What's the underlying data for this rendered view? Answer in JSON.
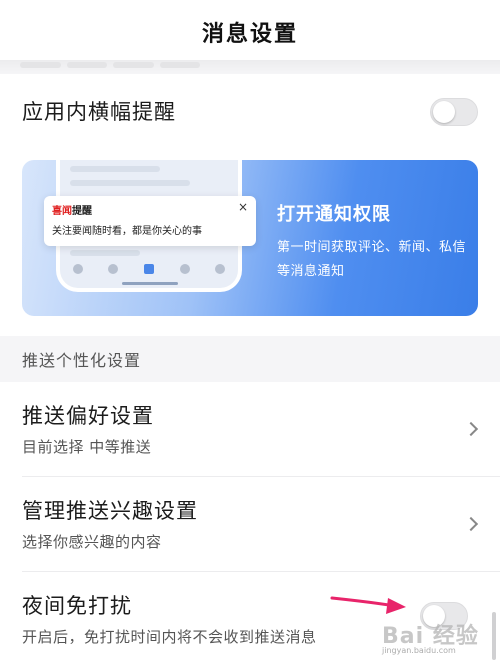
{
  "header": {
    "title": "消息设置"
  },
  "banner_toggle": {
    "label": "应用内横幅提醒",
    "state": "off"
  },
  "promo": {
    "notification_brand_red": "喜闻",
    "notification_brand_dark": "提醒",
    "notification_text": "关注要闻随时看，都是你关心的事",
    "close_glyph": "×",
    "title": "打开通知权限",
    "description": "第一时间获取评论、新闻、私信等消息通知"
  },
  "section": {
    "title": "推送个性化设置"
  },
  "items": [
    {
      "title": "推送偏好设置",
      "subtitle": "目前选择 中等推送"
    },
    {
      "title": "管理推送兴趣设置",
      "subtitle": "选择你感兴趣的内容"
    },
    {
      "title": "夜间免打扰",
      "subtitle": "开启后，免打扰时间内将不会收到推送消息",
      "state": "off"
    }
  ],
  "watermark": {
    "text": "Bai 经验",
    "sub": "jingyan.baidu.com"
  },
  "colors": {
    "arrow": "#e8246a",
    "banner_accent": "#4f8ef0"
  }
}
